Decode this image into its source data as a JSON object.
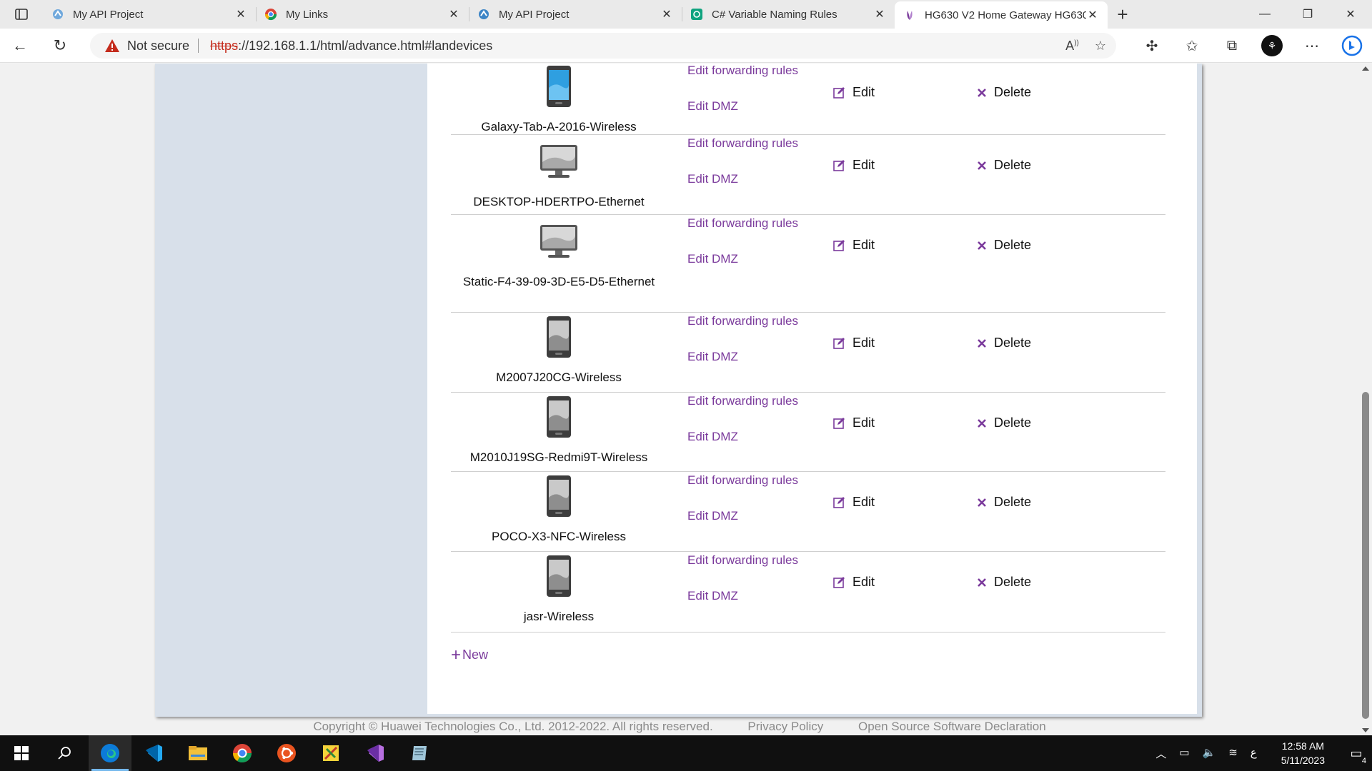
{
  "browser": {
    "tabs": [
      {
        "title": "My API Project",
        "active": false
      },
      {
        "title": "My Links",
        "active": false
      },
      {
        "title": "My API Project",
        "active": false
      },
      {
        "title": "C# Variable Naming Rules",
        "active": false
      },
      {
        "title": "HG630 V2 Home Gateway HG630",
        "active": true
      }
    ],
    "new_tab": "+",
    "security_label": "Not secure",
    "url_scheme": "https",
    "url_rest": "://192.168.1.1/html/advance.html#landevices"
  },
  "devices": [
    {
      "name": "Galaxy-Tab-A-2016-Wireless",
      "type": "phone"
    },
    {
      "name": "DESKTOP-HDERTPO-Ethernet",
      "type": "monitor"
    },
    {
      "name": "Static-F4-39-09-3D-E5-D5-Ethernet",
      "type": "monitor"
    },
    {
      "name": "M2007J20CG-Wireless",
      "type": "phone-gray"
    },
    {
      "name": "M2010J19SG-Redmi9T-Wireless",
      "type": "phone-gray"
    },
    {
      "name": "POCO-X3-NFC-Wireless",
      "type": "phone-gray"
    },
    {
      "name": "jasr-Wireless",
      "type": "phone-gray"
    }
  ],
  "actions": {
    "forwarding": "Edit forwarding rules",
    "dmz": "Edit DMZ",
    "edit": "Edit",
    "delete": "Delete",
    "new": "New"
  },
  "footer": {
    "copyright": "Copyright © Huawei Technologies Co., Ltd. 2012-2022. All rights reserved.",
    "privacy": "Privacy Policy",
    "oss": "Open Source Software Declaration"
  },
  "taskbar": {
    "time": "12:58 AM",
    "date": "5/11/2023",
    "notification_count": "4",
    "lang": "ع"
  },
  "colors": {
    "link": "#7b3b9c",
    "frame": "#d8e0ea",
    "taskbar": "#101010"
  }
}
